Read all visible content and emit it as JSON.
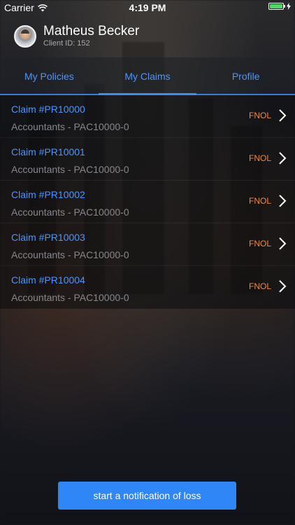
{
  "status_bar": {
    "carrier": "Carrier",
    "time": "4:19 PM",
    "battery_color": "#4cd964"
  },
  "user": {
    "name": "Matheus Becker",
    "client_id": "Client ID: 152"
  },
  "tabs": [
    {
      "label": "My Policies",
      "active": false
    },
    {
      "label": "My Claims",
      "active": true
    },
    {
      "label": "Profile",
      "active": false
    }
  ],
  "claims": [
    {
      "title": "Claim #PR10000",
      "subtitle": "Accountants - PAC10000-0",
      "status": "FNOL"
    },
    {
      "title": "Claim #PR10001",
      "subtitle": "Accountants - PAC10000-0",
      "status": "FNOL"
    },
    {
      "title": "Claim #PR10002",
      "subtitle": "Accountants - PAC10000-0",
      "status": "FNOL"
    },
    {
      "title": "Claim #PR10003",
      "subtitle": "Accountants - PAC10000-0",
      "status": "FNOL"
    },
    {
      "title": "Claim #PR10004",
      "subtitle": "Accountants - PAC10000-0",
      "status": "FNOL"
    }
  ],
  "cta": {
    "label": "start a notification of loss"
  },
  "colors": {
    "accent": "#3d8bff",
    "status_orange": "#f08a3e",
    "button": "#2f86f6"
  },
  "icons": {
    "wifi": "wifi-icon",
    "battery": "battery-icon",
    "row_chevron": "chevron-right-icon",
    "avatar": "avatar"
  }
}
